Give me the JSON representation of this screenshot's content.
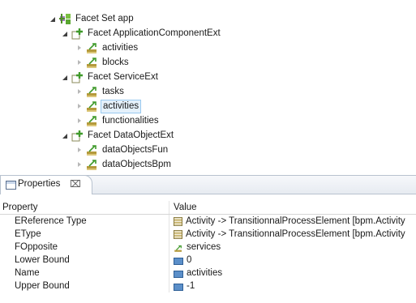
{
  "tree": {
    "nodes": [
      {
        "label": "Facet Set app",
        "state": "open",
        "icon": "facet-set-icon",
        "selected": false
      },
      {
        "label": "Facet ApplicationComponentExt",
        "state": "open",
        "icon": "facet-icon",
        "selected": false
      },
      {
        "label": "activities",
        "state": "closed",
        "icon": "reference-icon",
        "selected": false
      },
      {
        "label": "blocks",
        "state": "closed",
        "icon": "reference-icon",
        "selected": false
      },
      {
        "label": "Facet ServiceExt",
        "state": "open",
        "icon": "facet-icon",
        "selected": false
      },
      {
        "label": "tasks",
        "state": "closed",
        "icon": "reference-icon",
        "selected": false
      },
      {
        "label": "activities",
        "state": "closed",
        "icon": "reference-icon",
        "selected": true
      },
      {
        "label": "functionalities",
        "state": "closed",
        "icon": "reference-icon",
        "selected": false
      },
      {
        "label": "Facet DataObjectExt",
        "state": "open",
        "icon": "facet-icon",
        "selected": false
      },
      {
        "label": "dataObjectsFun",
        "state": "closed",
        "icon": "reference-icon",
        "selected": false
      },
      {
        "label": "dataObjectsBpm",
        "state": "closed",
        "icon": "reference-icon",
        "selected": false
      }
    ]
  },
  "properties_view": {
    "tab_label": "Properties",
    "tab_close": "⌧",
    "columns": {
      "property": "Property",
      "value": "Value"
    },
    "rows": [
      {
        "property": "EReference Type",
        "value": "Activity -> TransitionnalProcessElement [bpm.Activity",
        "icon": "class-icon"
      },
      {
        "property": "EType",
        "value": "Activity -> TransitionnalProcessElement [bpm.Activity",
        "icon": "class-icon"
      },
      {
        "property": "FOpposite",
        "value": "services",
        "icon": "reference-icon"
      },
      {
        "property": "Lower Bound",
        "value": "0",
        "icon": "number-icon"
      },
      {
        "property": "Name",
        "value": "activities",
        "icon": "text-icon"
      },
      {
        "property": "Upper Bound",
        "value": "-1",
        "icon": "number-icon"
      }
    ]
  }
}
